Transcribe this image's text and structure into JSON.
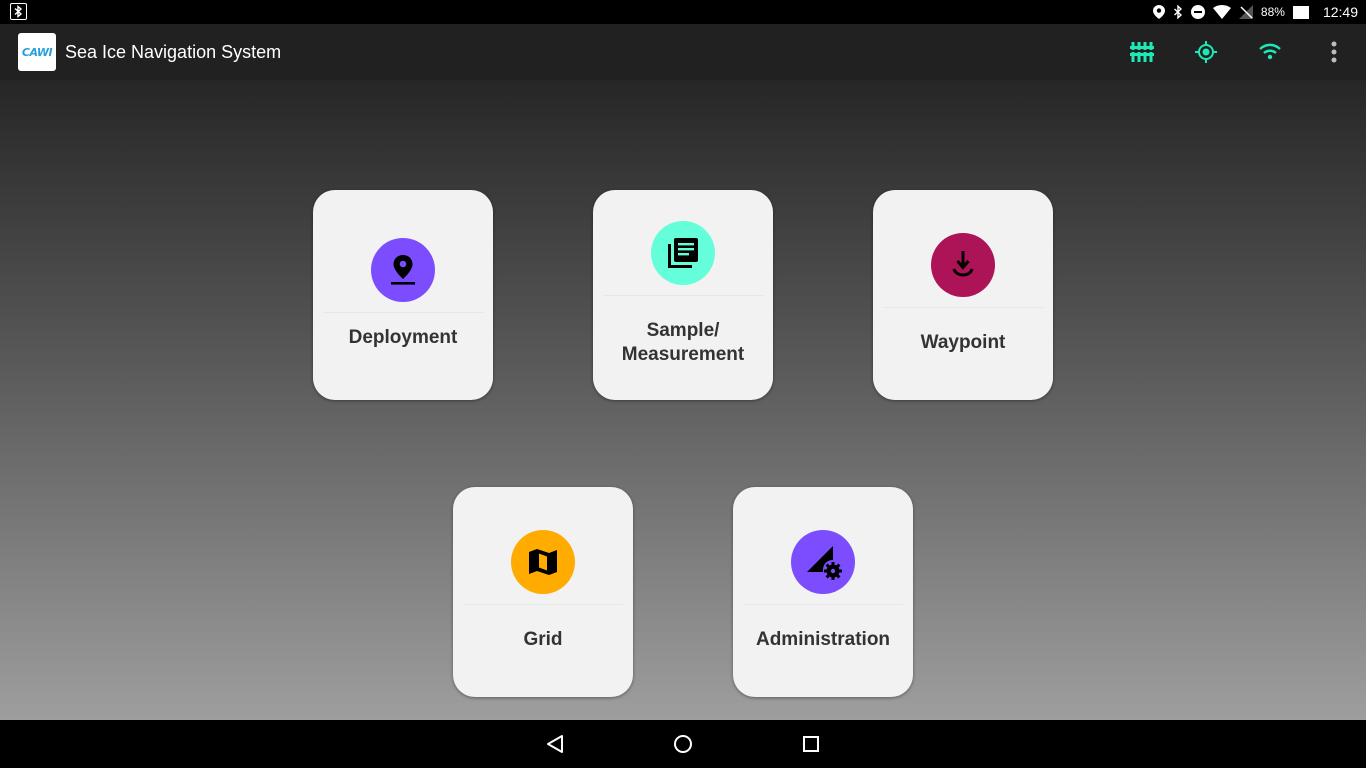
{
  "status_bar": {
    "battery_percent": "88%",
    "time": "12:49",
    "icons": [
      "bluetooth-notification-icon",
      "location-icon",
      "bluetooth-icon",
      "do-not-disturb-icon",
      "wifi-icon",
      "no-signal-icon",
      "battery-icon"
    ]
  },
  "app_bar": {
    "logo_text": "CAWI",
    "title": "Sea Ice Navigation System",
    "actions": [
      "sensor-array-icon",
      "gps-fix-icon",
      "wifi-icon",
      "overflow-menu-icon"
    ],
    "accent_color": "#1de9b6"
  },
  "tiles": [
    {
      "label": "Deployment",
      "icon": "place-pin-icon",
      "color": "#7c4dff"
    },
    {
      "label_line1": "Sample/",
      "label_line2": "Measurement",
      "icon": "library-books-icon",
      "color": "#64ffda"
    },
    {
      "label": "Waypoint",
      "icon": "anchor-down-icon",
      "color": "#ad1457"
    },
    {
      "label": "Grid",
      "icon": "map-icon",
      "color": "#ffab00"
    },
    {
      "label": "Administration",
      "icon": "signal-settings-icon",
      "color": "#7c4dff"
    }
  ],
  "nav_bar": {
    "buttons": [
      "back-icon",
      "home-icon",
      "recents-icon"
    ]
  }
}
